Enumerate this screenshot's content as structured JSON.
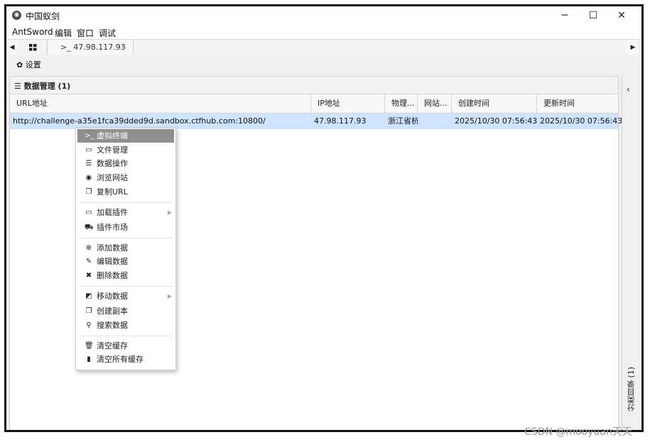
{
  "window": {
    "title": "中国蚁剑",
    "minimize": "─",
    "maximize": "☐",
    "close": "✕"
  },
  "menu": [
    "AntSword",
    "编辑",
    "窗口",
    "调试"
  ],
  "tabs": {
    "home_icon": "grid-icon",
    "shell_tab": "47.98.117.93",
    "shell_prefix": ">_",
    "close": "×"
  },
  "toolbar": {
    "settings": "设置"
  },
  "panel": {
    "title": "数据管理 (1)"
  },
  "table": {
    "columns": [
      "URL地址",
      "IP地址",
      "物理...",
      "网站...",
      "创建时间",
      "更新时间"
    ],
    "rows": [
      {
        "url": "http://challenge-a35e1fca39dded9d.sandbox.ctfhub.com:10800/",
        "ip": "47.98.117.93",
        "location": "浙江省杭",
        "site": "",
        "created": "2025/10/30 07:56:43",
        "updated": "2025/10/30 07:56:43"
      }
    ]
  },
  "sidebar": {
    "collapse": "‹",
    "vertical_label": "分类目录 (1)"
  },
  "context_menu": {
    "items": [
      {
        "label": "虚拟终端",
        "icon": "terminal-icon"
      },
      {
        "label": "文件管理",
        "icon": "folder-icon"
      },
      {
        "label": "数据操作",
        "icon": "database-icon"
      },
      {
        "label": "浏览网站",
        "icon": "chrome-icon"
      },
      {
        "label": "复制URL",
        "icon": "copy-icon"
      },
      {
        "label": "加载插件",
        "icon": "folder-icon"
      },
      {
        "label": "插件市场",
        "icon": "cart-icon"
      },
      {
        "label": "添加数据",
        "icon": "plus-circle-icon"
      },
      {
        "label": "编辑数据",
        "icon": "edit-icon"
      },
      {
        "label": "删除数据",
        "icon": "times-icon"
      },
      {
        "label": "移动数据",
        "icon": "move-icon"
      },
      {
        "label": "创建副本",
        "icon": "copy-icon"
      },
      {
        "label": "搜索数据",
        "icon": "search-icon"
      },
      {
        "label": "清空缓存",
        "icon": "trash-icon"
      },
      {
        "label": "清空所有缓存",
        "icon": "trash-solid-icon"
      }
    ]
  },
  "watermark": "CSDN @mooyuan天天",
  "colors": {
    "selected_row": "#cfe4ff",
    "menu_active": "#8e8e8e"
  }
}
